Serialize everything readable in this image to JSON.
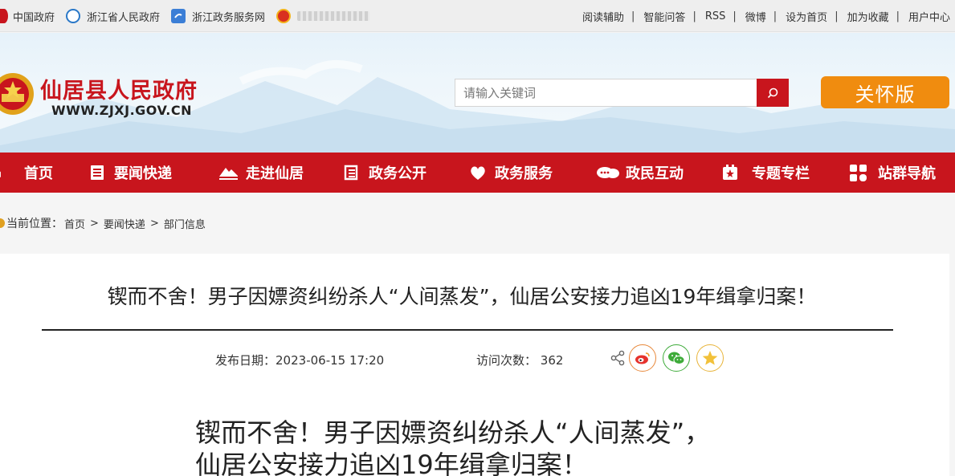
{
  "top_left_links": [
    {
      "label": "中国政府",
      "icon": "national-emblem-icon"
    },
    {
      "label": "浙江省人民政府",
      "icon": "zhejiang-gov-icon"
    },
    {
      "label": "浙江政务服务网",
      "icon": "zhejiang-service-icon"
    }
  ],
  "top_right_links": [
    "阅读辅助",
    "智能问答",
    "RSS",
    "微博",
    "设为首页",
    "加为收藏",
    "用户中心"
  ],
  "top_right_separator": "|",
  "header": {
    "title": "仙居县人民政府",
    "url": "WWW.ZJXJ.GOV.CN",
    "search_placeholder": "请输入关键词",
    "care_button": "关怀版"
  },
  "nav": [
    {
      "label": "首页",
      "icon": "home-icon"
    },
    {
      "label": "要闻快递",
      "icon": "news-icon"
    },
    {
      "label": "走进仙居",
      "icon": "mountain-icon"
    },
    {
      "label": "政务公开",
      "icon": "document-icon"
    },
    {
      "label": "政务服务",
      "icon": "heart-icon"
    },
    {
      "label": "政民互动",
      "icon": "chat-icon"
    },
    {
      "label": "专题专栏",
      "icon": "star-folder-icon"
    },
    {
      "label": "站群导航",
      "icon": "grid-icon"
    }
  ],
  "breadcrumb": {
    "label": "当前位置：",
    "items": [
      "首页",
      "要闻快递",
      "部门信息"
    ],
    "separator": ">"
  },
  "article": {
    "title": "锲而不舍！男子因嫖资纠纷杀人“人间蒸发”，仙居公安接力追凶19年缉拿归案！",
    "publish_label": "发布日期：",
    "publish_date": "2023-06-15 17:20",
    "visits_label": "访问次数：",
    "visits": "362",
    "body_title_line1": "锲而不舍！男子因嫖资纠纷杀人“人间蒸发”，",
    "body_title_line2": "仙居公安接力追凶19年缉拿归案！"
  },
  "colors": {
    "primary_red": "#c8151d",
    "care_orange": "#f08c0f",
    "weibo": "#e8883a",
    "wechat": "#3eab3a",
    "favorite": "#e8b43a"
  }
}
